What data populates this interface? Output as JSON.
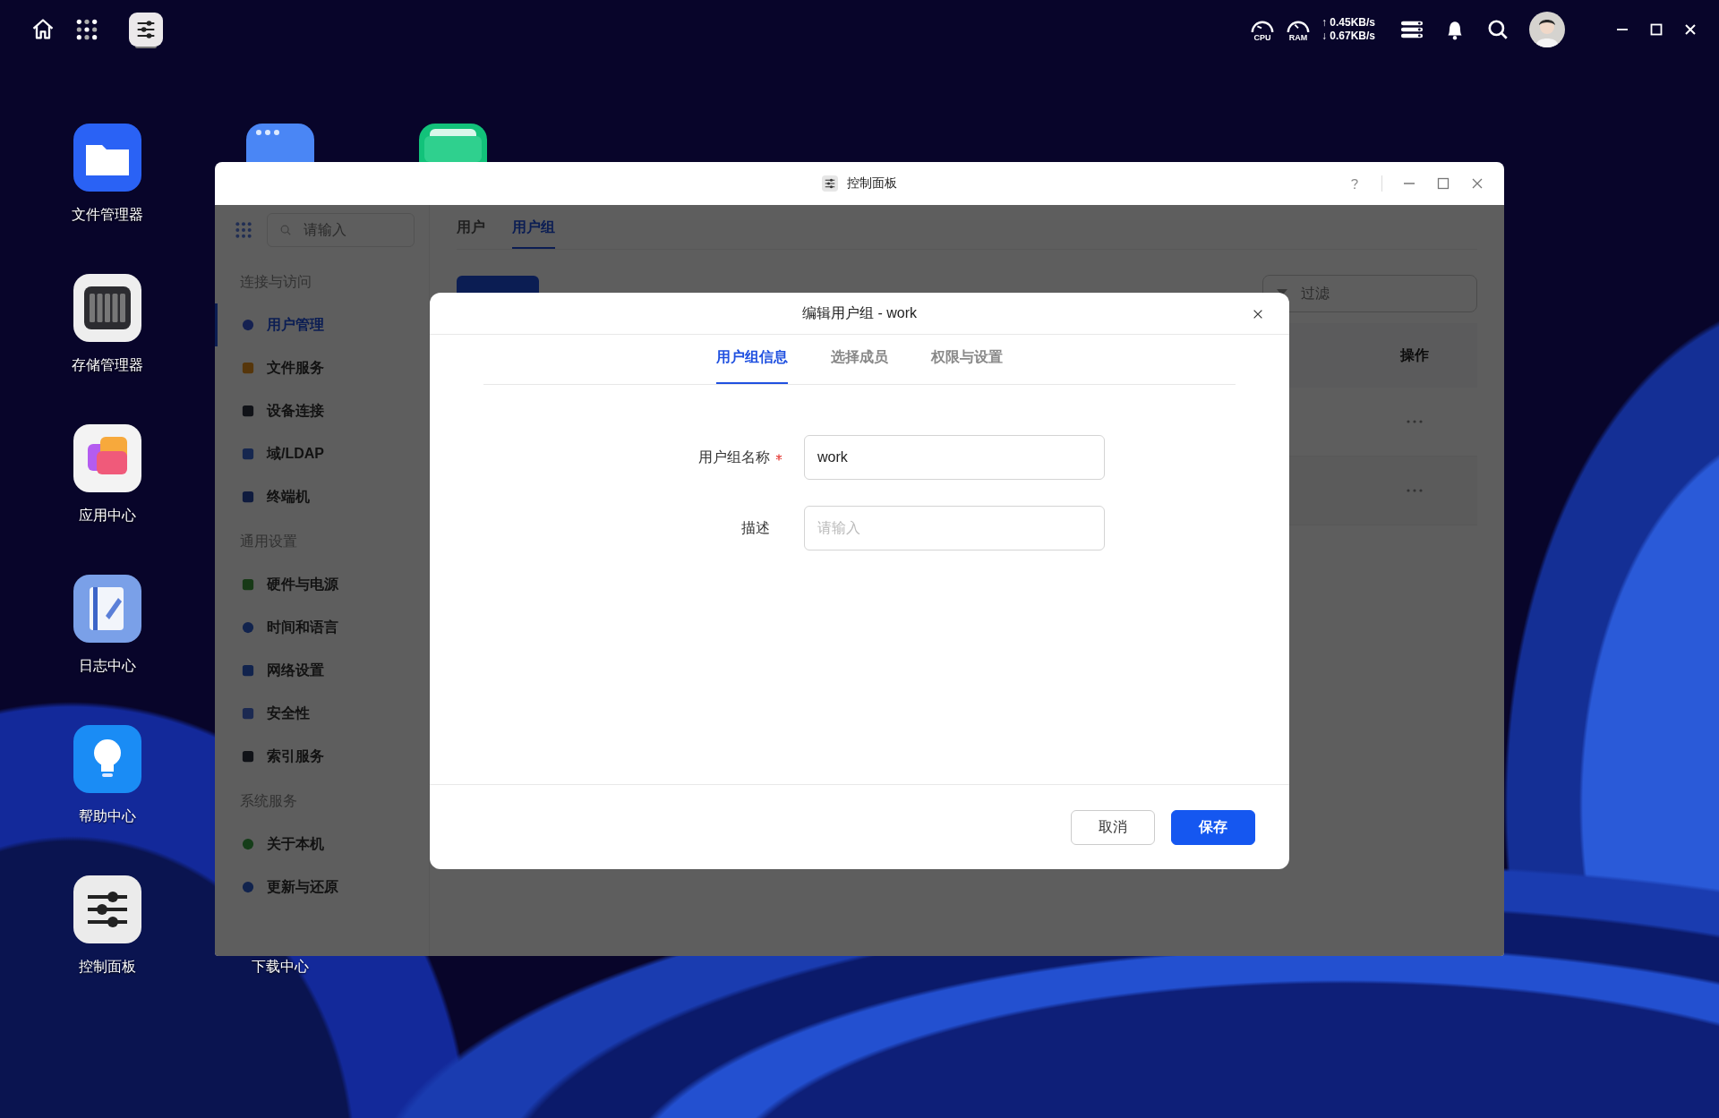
{
  "top_bar": {
    "cpu_label": "CPU",
    "ram_label": "RAM",
    "upload": "↑ 0.45KB/s",
    "download": "↓ 0.67KB/s"
  },
  "desktop_icons": [
    {
      "label": "文件管理器",
      "kind": "files"
    },
    {
      "label": "存储管理器",
      "kind": "storage"
    },
    {
      "label": "应用中心",
      "kind": "apps"
    },
    {
      "label": "日志中心",
      "kind": "log"
    },
    {
      "label": "帮助中心",
      "kind": "help"
    },
    {
      "label": "控制面板",
      "kind": "control"
    },
    {
      "label": "下载中心",
      "kind": "download"
    }
  ],
  "window": {
    "title": "控制面板",
    "sidebar": {
      "search_placeholder": "请输入",
      "sections": [
        {
          "heading": "连接与访问",
          "items": [
            {
              "label": "用户管理",
              "kind": "user",
              "selected": true
            },
            {
              "label": "文件服务",
              "kind": "folder",
              "selected": false
            },
            {
              "label": "设备连接",
              "kind": "device",
              "selected": false
            },
            {
              "label": "域/LDAP",
              "kind": "ldap",
              "selected": false
            },
            {
              "label": "终端机",
              "kind": "terminal",
              "selected": false
            }
          ]
        },
        {
          "heading": "通用设置",
          "items": [
            {
              "label": "硬件与电源",
              "kind": "hardware",
              "selected": false
            },
            {
              "label": "时间和语言",
              "kind": "globe",
              "selected": false
            },
            {
              "label": "网络设置",
              "kind": "network",
              "selected": false
            },
            {
              "label": "安全性",
              "kind": "shield",
              "selected": false
            },
            {
              "label": "索引服务",
              "kind": "index",
              "selected": false
            }
          ]
        },
        {
          "heading": "系统服务",
          "items": [
            {
              "label": "关于本机",
              "kind": "info",
              "selected": false
            },
            {
              "label": "更新与还原",
              "kind": "update",
              "selected": false
            }
          ]
        }
      ]
    },
    "tabs": [
      {
        "label": "用户",
        "selected": false
      },
      {
        "label": "用户组",
        "selected": true
      }
    ],
    "filter_placeholder": "过滤",
    "table": {
      "columns": [
        "操作"
      ]
    }
  },
  "dialog": {
    "title": "编辑用户组 - work",
    "tabs": [
      {
        "label": "用户组信息",
        "selected": true
      },
      {
        "label": "选择成员",
        "selected": false
      },
      {
        "label": "权限与设置",
        "selected": false
      }
    ],
    "fields": [
      {
        "label": "用户组名称",
        "required": true,
        "value": "work"
      },
      {
        "label": "描述",
        "required": false,
        "placeholder": "请输入"
      }
    ],
    "buttons": [
      {
        "label": "取消",
        "kind": "secondary"
      },
      {
        "label": "保存",
        "kind": "primary"
      }
    ]
  }
}
